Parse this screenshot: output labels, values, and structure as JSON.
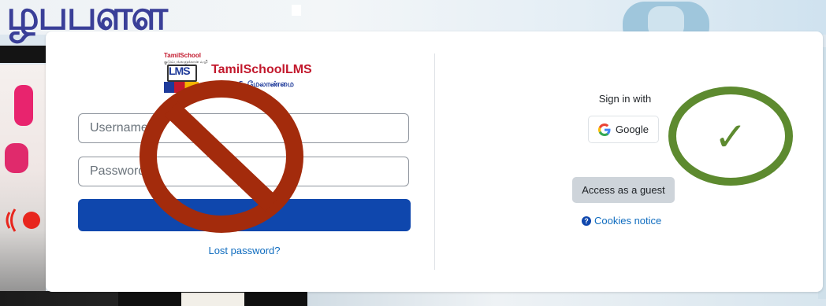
{
  "background": {
    "tamil_text": "ழபபளள"
  },
  "logo": {
    "emblem_top": "TamilSchool",
    "emblem_small": "குடும்பங்களுக்கான வழி",
    "emblem_lms": "LMS",
    "title": "TamilSchoolLMS",
    "subtitle": "கற்றல் & மேலாண்மை"
  },
  "login_form": {
    "username_placeholder": "Username",
    "password_placeholder": "Password",
    "login_button_label": "",
    "lost_password_link": "Lost password?"
  },
  "identity_providers": {
    "heading": "Sign in with",
    "google_label": "Google"
  },
  "guest": {
    "button_label": "Access as a guest"
  },
  "cookies": {
    "label": "Cookies notice",
    "icon_glyph": "?"
  },
  "annotations": {
    "prohibited_icon": "no-entry-sign",
    "approved_icon": "check-mark-circle",
    "prohibited_color": "#a32b0c",
    "approved_color": "#5d8a2f",
    "check_glyph": "✓"
  },
  "colors": {
    "primary_button": "#0f47ad",
    "link": "#0f6cbf",
    "guest_button": "#ced4da"
  }
}
